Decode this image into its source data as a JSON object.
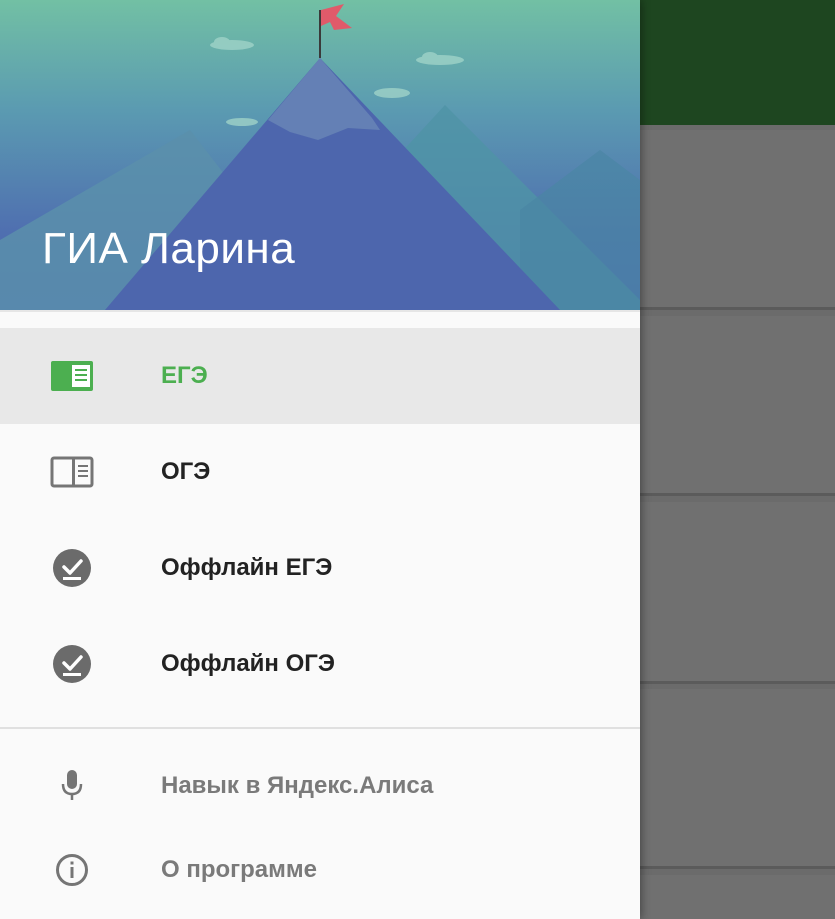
{
  "app": {
    "title": "ГИА Ларина"
  },
  "drawer": {
    "primary_items": [
      {
        "label": "ЕГЭ",
        "icon": "book-open-icon",
        "selected": true
      },
      {
        "label": "ОГЭ",
        "icon": "book-open-outline-icon",
        "selected": false
      },
      {
        "label": "Оффлайн ЕГЭ",
        "icon": "download-done-icon",
        "selected": false
      },
      {
        "label": "Оффлайн ОГЭ",
        "icon": "download-done-icon",
        "selected": false
      }
    ],
    "secondary_items": [
      {
        "label": "Навык в Яндекс.Алиса",
        "icon": "microphone-icon"
      },
      {
        "label": "О программе",
        "icon": "info-icon"
      }
    ]
  },
  "colors": {
    "accent": "#4caf50",
    "toolbar_bg": "#1e4620",
    "header_top": "#72c0a4",
    "header_bottom": "#4c64b2",
    "flag": "#e05a6a"
  }
}
